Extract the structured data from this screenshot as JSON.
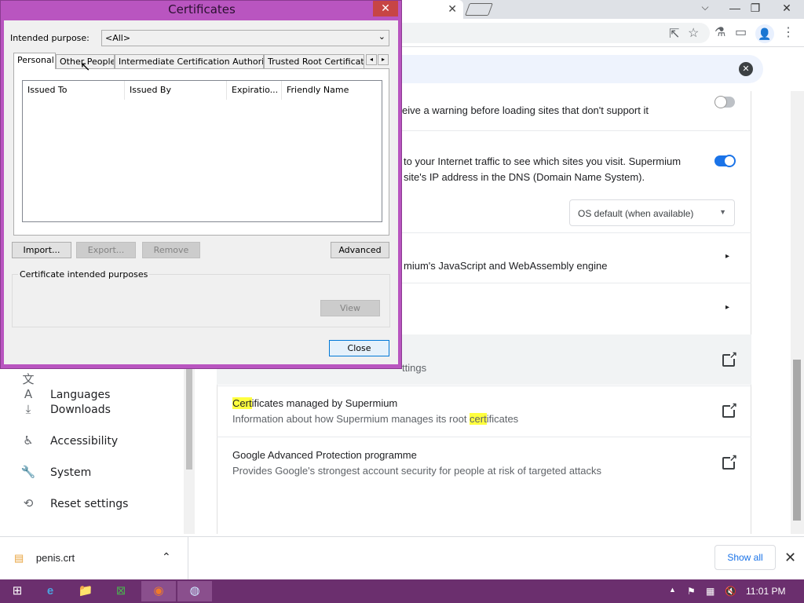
{
  "browser": {
    "close_tab": "✕",
    "win_min": "—",
    "win_max": "❐",
    "win_close": "✕",
    "tab_dropdown": "⌵",
    "icons": {
      "share": "⇱",
      "star": "☆",
      "lab": "⚗",
      "sidebar": "▭",
      "profile": "👤",
      "menu": "⋮"
    },
    "search_clear": "✕"
  },
  "settings": {
    "rows": [
      {
        "id": "https-first",
        "text": "eive a warning before loading sites that don't support it"
      },
      {
        "id": "secure-dns-1",
        "text": "to your Internet traffic to see which sites you visit. Supermium"
      },
      {
        "id": "secure-dns-2",
        "text": "site's IP address in the DNS (Domain Name System)."
      },
      {
        "id": "v8",
        "text": "mium's JavaScript and WebAssembly engine"
      },
      {
        "id": "manage-certs",
        "text": "ttings"
      },
      {
        "id": "certs-supermium-title-a",
        "text": "Cert"
      },
      {
        "id": "certs-supermium-title-b",
        "text": "ificates managed by Supermium"
      },
      {
        "id": "certs-supermium-sub-a",
        "text": "Information about how Supermium manages its root "
      },
      {
        "id": "certs-supermium-sub-b",
        "text": "cert"
      },
      {
        "id": "certs-supermium-sub-c",
        "text": "ificates"
      },
      {
        "id": "gap-title",
        "text": "Google Advanced Protection programme"
      },
      {
        "id": "gap-sub",
        "text": "Provides Google's strongest account security for people at risk of targeted attacks"
      }
    ],
    "dns_select": "OS default (when available)",
    "https_first_enabled": false,
    "secure_dns_enabled": true,
    "chevron": "▸"
  },
  "sidebar": {
    "items": [
      {
        "label": "Languages",
        "icon": "文A"
      },
      {
        "label": "Downloads",
        "icon": "⤓"
      },
      {
        "label": "Accessibility",
        "icon": "♿"
      },
      {
        "label": "System",
        "icon": "🔧"
      },
      {
        "label": "Reset settings",
        "icon": "⟲"
      }
    ]
  },
  "downloads": {
    "file": "penis.crt",
    "chevron": "⌃",
    "show_all": "Show all",
    "close": "✕"
  },
  "taskbar": {
    "time": "11:01 PM",
    "tray_icons": [
      "▲",
      "⚑",
      "▦",
      "🔇"
    ],
    "apps": [
      "⊞",
      "e",
      "📁",
      "⊠",
      "◉",
      "◍"
    ]
  },
  "dialog": {
    "title": "Certificates",
    "close": "✕",
    "purpose_label": "Intended purpose:",
    "purpose_value": "<All>",
    "tabs": [
      "Personal",
      "Other People",
      "Intermediate Certification Authorities",
      "Trusted Root Certification"
    ],
    "tab_scroll_left": "◂",
    "tab_scroll_right": "▸",
    "columns": [
      "Issued To",
      "Issued By",
      "Expiratio...",
      "Friendly Name"
    ],
    "buttons": {
      "import": "Import...",
      "export": "Export...",
      "remove": "Remove",
      "advanced": "Advanced",
      "view": "View",
      "close": "Close"
    },
    "purposes_group": "Certificate intended purposes"
  },
  "colors": {
    "dialog_frame": "#b955c0",
    "taskbar": "#6b2f6e",
    "accent": "#1a73e8",
    "highlight": "#ffff3f"
  }
}
